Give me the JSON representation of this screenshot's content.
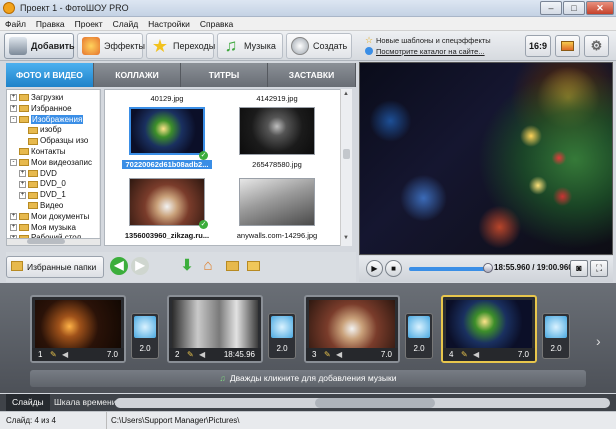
{
  "window": {
    "title": "Проект 1 - ФотоШОУ PRO"
  },
  "menu": [
    "Файл",
    "Правка",
    "Проект",
    "Слайд",
    "Настройки",
    "Справка"
  ],
  "toolbar": {
    "add": "Добавить",
    "effects": "Эффекты",
    "transitions": "Переходы",
    "music": "Музыка",
    "create": "Создать"
  },
  "right_toolbar": {
    "new_templates": "Новые шаблоны и спецэффекты",
    "catalog": "Посмотрите каталог на сайте...",
    "aspect": "16:9"
  },
  "tabs": [
    "ФОТО И ВИДЕО",
    "КОЛЛАЖИ",
    "ТИТРЫ",
    "ЗАСТАВКИ"
  ],
  "tree": [
    {
      "label": "Загрузки",
      "indent": 0,
      "exp": "+"
    },
    {
      "label": "Избранное",
      "indent": 0,
      "exp": "+"
    },
    {
      "label": "Изображения",
      "indent": 0,
      "exp": "-",
      "selected": true
    },
    {
      "label": "изобр",
      "indent": 1,
      "exp": ""
    },
    {
      "label": "Образцы изо",
      "indent": 1,
      "exp": ""
    },
    {
      "label": "Контакты",
      "indent": 0,
      "exp": ""
    },
    {
      "label": "Мои видеозапис",
      "indent": 0,
      "exp": "-"
    },
    {
      "label": "DVD",
      "indent": 1,
      "exp": "+"
    },
    {
      "label": "DVD_0",
      "indent": 1,
      "exp": "+"
    },
    {
      "label": "DVD_1",
      "indent": 1,
      "exp": "+"
    },
    {
      "label": "Видео",
      "indent": 1,
      "exp": ""
    },
    {
      "label": "Мои документы",
      "indent": 0,
      "exp": "+"
    },
    {
      "label": "Моя музыка",
      "indent": 0,
      "exp": "+"
    },
    {
      "label": "Рабочий стол",
      "indent": 0,
      "exp": "+"
    }
  ],
  "thumbs": {
    "top_labels": [
      "40129.jpg",
      "4142919.jpg"
    ],
    "items": [
      "70220062d61b08adb2...",
      "265478580.jpg",
      "1356003960_zikzag.ru...",
      "anywalls.com-14296.jpg"
    ]
  },
  "favorites": "Избранные папки",
  "player": {
    "time": "18:55.960 / 19:00.960",
    "progress": 0.995
  },
  "slides": [
    {
      "num": "1",
      "dur": "7.0",
      "trans": "2.0"
    },
    {
      "num": "2",
      "dur": "18:45.96",
      "trans": "2.0"
    },
    {
      "num": "3",
      "dur": "7.0",
      "trans": "2.0"
    },
    {
      "num": "4",
      "dur": "7.0",
      "trans": "2.0"
    }
  ],
  "music_hint": "Дважды кликните для добавления музыки",
  "bottom_tabs": [
    "Слайды",
    "Шкала времени"
  ],
  "status": {
    "slide": "Слайд: 4 из 4",
    "path": "C:\\Users\\Support Manager\\Pictures\\"
  }
}
